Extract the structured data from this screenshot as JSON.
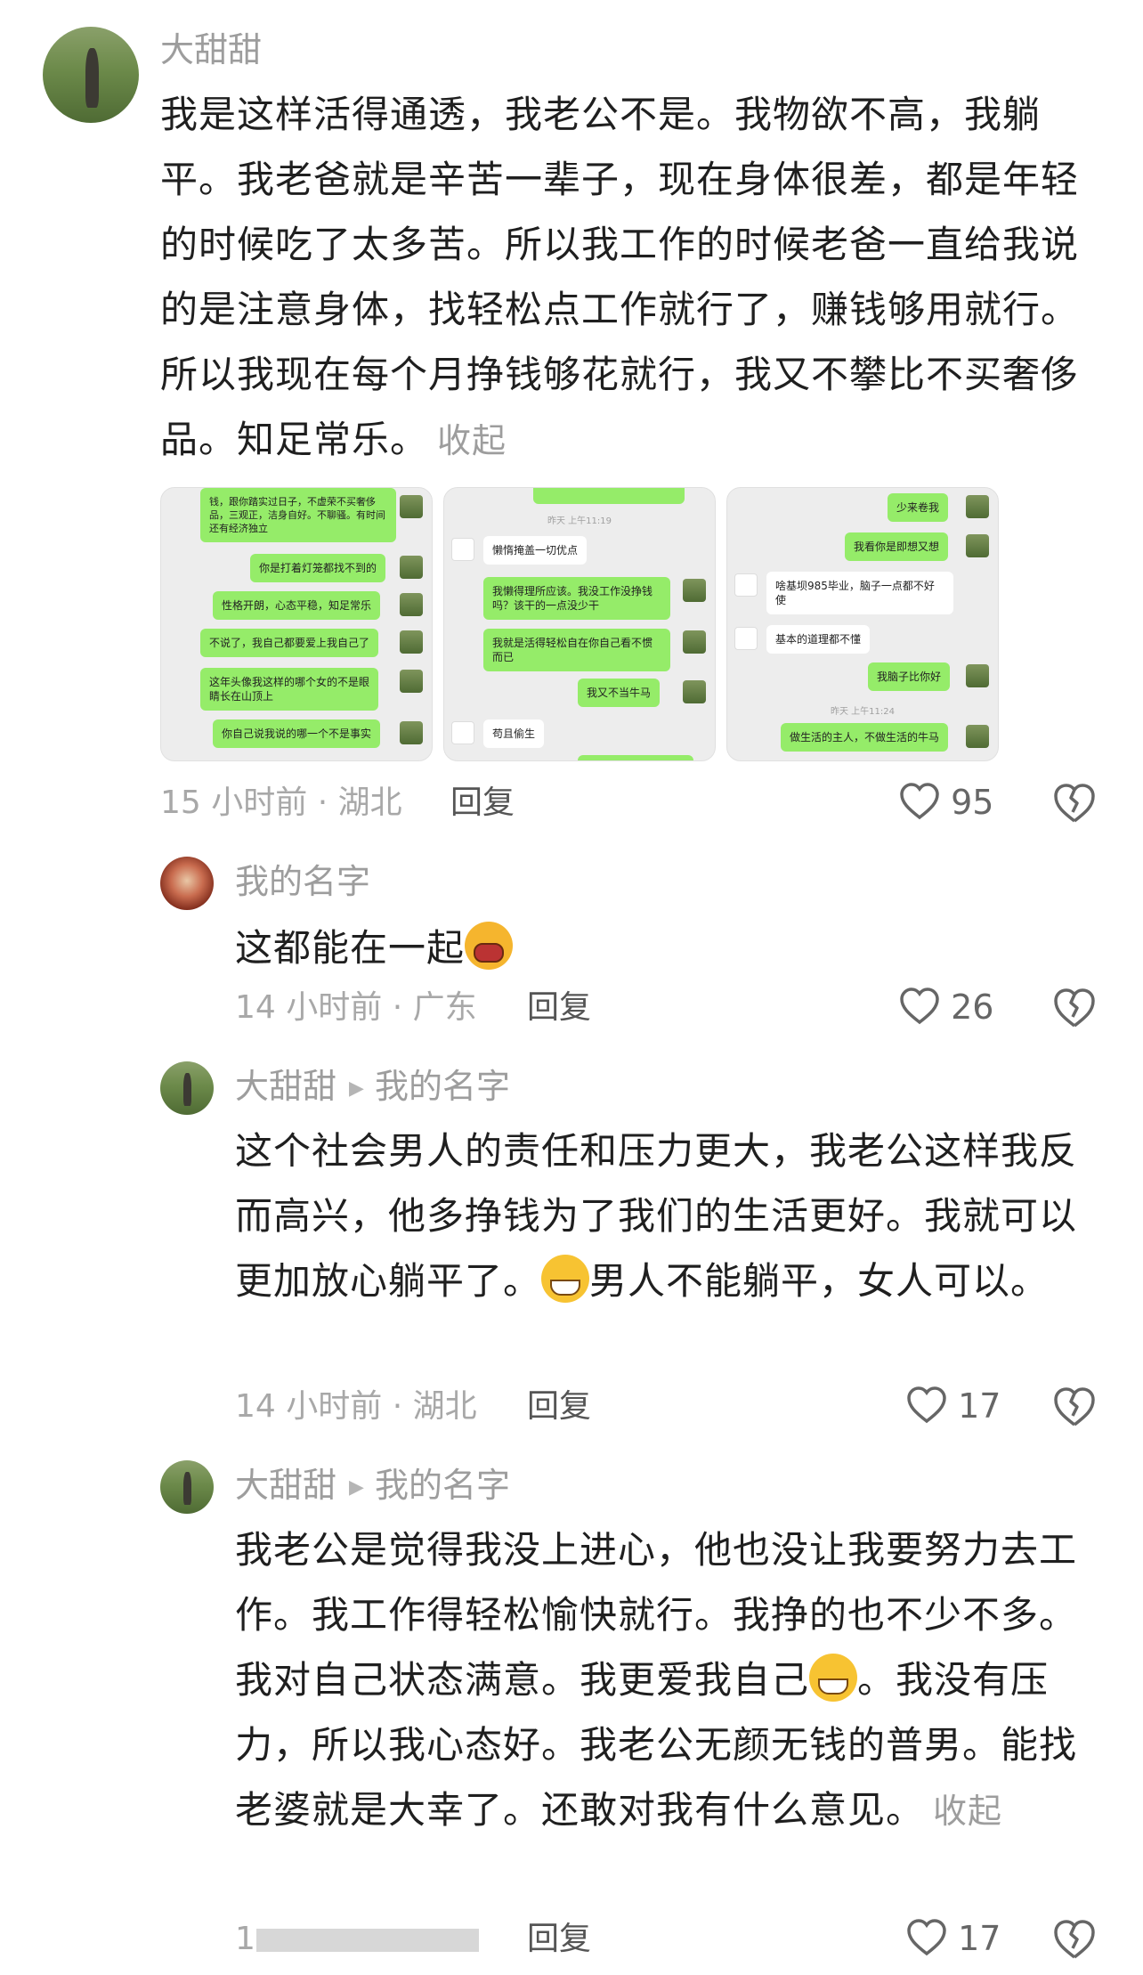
{
  "comments": [
    {
      "user": "大甜甜",
      "text": "我是这样活得通透，我老公不是。我物欲不高，我躺平。我老爸就是辛苦一辈子，现在身体很差，都是年轻的时候吃了太多苦。所以我工作的时候老爸一直给我说的是注意身体，找轻松点工作就行了，赚钱够用就行。所以我现在每个月挣钱够花就行，我又不攀比不买奢侈品。知足常乐。",
      "collapse": "收起",
      "meta": "15 小时前 · 湖北",
      "reply": "回复",
      "likes": "95"
    },
    {
      "user": "我的名字",
      "text": "这都能在一起",
      "meta": "14 小时前 · 广东",
      "reply": "回复",
      "likes": "26"
    },
    {
      "user": "大甜甜",
      "reply_to": "我的名字",
      "text_a": "这个社会男人的责任和压力更大，我老公这样我反而高兴，他多挣钱为了我们的生活更好。我就可以更加放心躺平了。",
      "text_b": "男人不能躺平，女人可以。",
      "meta": "14 小时前 · 湖北",
      "reply": "回复",
      "likes": "17"
    },
    {
      "user": "大甜甜",
      "reply_to": "我的名字",
      "text_a": "我老公是觉得我没上进心，他也没让我要努力去工作。我工作得轻松愉快就行。我挣的也不少不多。我对自己状态满意。我更爱我自己",
      "text_b": "。我没有压力，所以我心态好。我老公无颜无钱的普男。能找老婆就是大幸了。还敢对我有什么意见。",
      "collapse": "收起",
      "meta": "1",
      "reply": "回复",
      "likes": "17"
    }
  ],
  "images": [
    {
      "bubbles": [
        {
          "side": "r",
          "text": "钱，跟你踏实过日子，不虚荣不买奢侈品，三观正，洁身自好。不聊骚。有时间还有经济独立"
        },
        {
          "side": "r",
          "text": "你是打着灯笼都找不到的"
        },
        {
          "side": "r",
          "text": "性格开朗，心态平稳，知足常乐"
        },
        {
          "side": "r",
          "text": "不说了，我自己都要爱上我自己了"
        },
        {
          "side": "r",
          "text": "这年头像我这样的哪个女的不是眼睛长在山顶上"
        },
        {
          "side": "r",
          "text": "你自己说我说的哪一个不是事实"
        }
      ]
    },
    {
      "timestamp": "昨天 上午11:19",
      "bubbles": [
        {
          "side": "l",
          "text": "懒惰掩盖一切优点"
        },
        {
          "side": "r",
          "text": "我懒得理所应该。我没工作没挣钱吗？该干的一点没少干"
        },
        {
          "side": "r",
          "text": "我就是活得轻松自在你自己看不惯而已"
        },
        {
          "side": "r",
          "text": "我又不当牛马"
        },
        {
          "side": "l",
          "text": "苟且偷生"
        }
      ]
    },
    {
      "timestamp": "昨天 上午11:24",
      "bubbles": [
        {
          "side": "r",
          "text": "少来卷我"
        },
        {
          "side": "r",
          "text": "我看你是即想又想"
        },
        {
          "side": "l",
          "text": "啥基坝985毕业，脑子一点都不好使"
        },
        {
          "side": "l",
          "text": "基本的道理都不懂"
        },
        {
          "side": "r",
          "text": "我脑子比你好"
        },
        {
          "side": "r",
          "text": "做生活的主人，不做生活的牛马"
        }
      ]
    }
  ],
  "icons": {
    "like": "heart-outline-icon",
    "dislike": "broken-heart-icon",
    "arrow": "triangle-right-icon"
  }
}
